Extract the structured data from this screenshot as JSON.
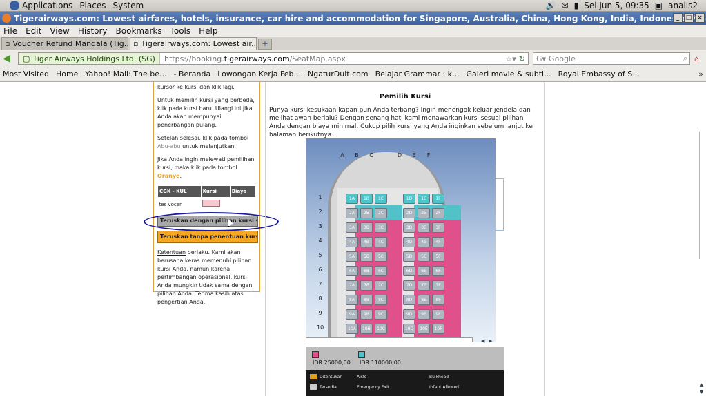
{
  "panel": {
    "menu": [
      "Applications",
      "Places",
      "System"
    ],
    "datetime": "Sel Jun  5, 09:35",
    "user": "analis2"
  },
  "window": {
    "title": "Tigerairways.com: Lowest airfares, hotels, insurance, car hire and accommodation for Singapore, Australia, China, Hong Kong, India, Indonesia, Macau, Malaysia, Philip"
  },
  "menubar": [
    "File",
    "Edit",
    "View",
    "History",
    "Bookmarks",
    "Tools",
    "Help"
  ],
  "tabs": [
    {
      "label": "Voucher Refund Mandala (Tig...",
      "active": false
    },
    {
      "label": "Tigerairways.com: Lowest air...",
      "active": true
    }
  ],
  "nav": {
    "site_identity": "Tiger Airways Holdings Ltd. (SG)",
    "url_prefix": "https://booking.",
    "url_domain": "tigerairways.com",
    "url_path": "/SeatMap.aspx",
    "search_placeholder": "Google"
  },
  "bookmarks": [
    "Most Visited",
    "Home",
    "Yahoo! Mail: The be...",
    "- Beranda",
    "Lowongan Kerja Feb...",
    "NgaturDuit.com",
    "Belajar Grammar : k...",
    "Galeri movie & subti...",
    "Royal Embassy of S..."
  ],
  "left": {
    "p0": "kursor ke kursi dan klik lagi.",
    "p1": "Untuk memilih kursi yang berbeda, klik pada kursi baru. Ulangi ini jika Anda akan mempunyai penerbangan pulang.",
    "p2_a": "Setelah selesai, klik pada tombol ",
    "p2_b": "Abu-abu",
    "p2_c": " untuk melanjutkan.",
    "p3_a": "Jika Anda ingin melewati pemilihan kursi, maka klik pada tombol ",
    "p3_b": "Oranye",
    "p3_c": ".",
    "table_head": [
      "CGK - KUL",
      "Kursi",
      "Biaya"
    ],
    "table_row_label": "tes vocer",
    "btn_continue": "Teruskan dengan pilihan kursi say",
    "btn_skip": "Teruskan tanpa penentuan kursi",
    "terms_link": "Ketentuan",
    "terms_text": " berlaku. Kami akan berusaha keras memenuhi pilihan kursi Anda, namun karena pertimbangan operasional, kursi Anda mungkin tidak sama dengan pilihan Anda. Terima kasih atas pengertian Anda."
  },
  "main": {
    "title": "Pemilih Kursi",
    "intro": "Punya kursi kesukaan kapan pun Anda terbang? Ingin menengok keluar jendela dan melihat awan berlalu? Dengan senang hati kami menawarkan kursi sesuai pilihan Anda dengan biaya minimal. Cukup pilih kursi yang Anda inginkan sebelum lanjut ke halaman berikutnya."
  },
  "seatmap": {
    "columns": [
      "A",
      "B",
      "C",
      "D",
      "E",
      "F"
    ],
    "rows": [
      1,
      2,
      3,
      4,
      5,
      6,
      7,
      8,
      9,
      10
    ]
  },
  "legend": {
    "price_pink": "IDR 25000,00",
    "price_teal": "IDR 110000,00",
    "pink_color": "#e0508a",
    "teal_color": "#50c2c8",
    "items": [
      "Ditentukan",
      "Aisle",
      "Bulkhead",
      "Tersedia",
      "Emergency Exit",
      "Infant Allowed"
    ]
  }
}
